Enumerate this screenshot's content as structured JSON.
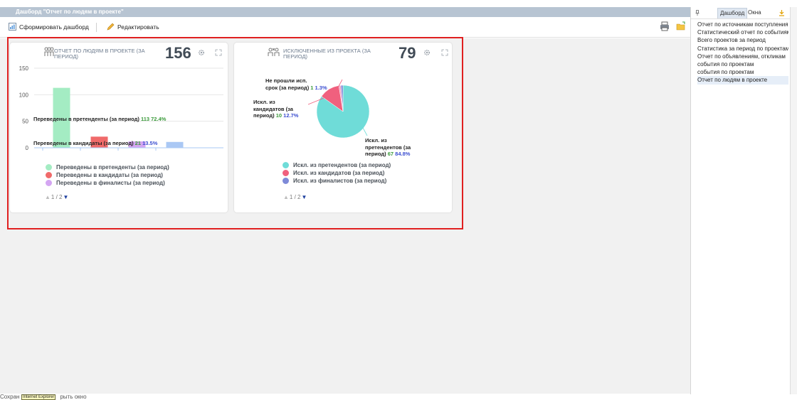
{
  "window": {
    "title": "Дашборд \"Отчет по людям в проекте\""
  },
  "toolbar": {
    "build_label": "Сформировать дашборд",
    "edit_label": "Редактировать"
  },
  "card1": {
    "title": "ОТЧЕТ ПО ЛЮДЯМ В ПРОЕКТЕ (ЗА ПЕРИОД)",
    "total": "156",
    "pager": "1 / 2",
    "label_a_text": "Переведены в претенденты (за период)",
    "label_a_count": "113",
    "label_a_pct": "72.4%",
    "label_b_text": "Переведены в кандидаты (за период)",
    "label_b_count": "21",
    "label_b_pct": "13.5%",
    "legend": [
      {
        "name": "Переведены в претенденты (за период)",
        "color": "#a4ecc3"
      },
      {
        "name": "Переведены в кандидаты (за период)",
        "color": "#f06a6a"
      },
      {
        "name": "Переведены в финалисты (за период)",
        "color": "#d4a6f2"
      }
    ]
  },
  "card2": {
    "title": "ИСКЛЮЧЕННЫЕ ИЗ ПРОЕКТА (ЗА ПЕРИОД)",
    "total": "79",
    "pager": "1 / 2",
    "label_1_line1": "Не прошли исп.",
    "label_1_line2": "срок (за период)",
    "label_1_count": "1",
    "label_1_pct": "1.3%",
    "label_2_line1": "Искл. из",
    "label_2_line2": "кандидатов (за",
    "label_2_line3": "период)",
    "label_2_count": "10",
    "label_2_pct": "12.7%",
    "label_3_line1": "Искл. из",
    "label_3_line2": "претендентов (за",
    "label_3_line3": "период)",
    "label_3_count": "67",
    "label_3_pct": "84.8%",
    "legend": [
      {
        "name": "Искл. из претендентов (за период)",
        "color": "#6fdcd8"
      },
      {
        "name": "Искл. из кандидатов (за период)",
        "color": "#f0607e"
      },
      {
        "name": "Искл. из финалистов (за период)",
        "color": "#7e8ad8"
      }
    ]
  },
  "chart_data": [
    {
      "type": "bar",
      "categories": [
        "Переведены в претенденты (за период)",
        "Переведены в кандидаты (за период)",
        "Переведены в финалисты (за период)",
        ""
      ],
      "values": [
        113,
        21,
        12,
        11
      ],
      "colors": [
        "#a4ecc3",
        "#f06a6a",
        "#d4a6f2",
        "#aac8f4"
      ],
      "yticks": [
        "0",
        "50",
        "100",
        "150"
      ],
      "ylim": [
        0,
        150
      ],
      "grid": true
    },
    {
      "type": "pie",
      "slices": [
        {
          "label": "Искл. из претендентов (за период)",
          "value": 67,
          "percent": 84.8,
          "color": "#6fdcd8"
        },
        {
          "label": "Искл. из кандидатов (за период)",
          "value": 10,
          "percent": 12.7,
          "color": "#f0607e"
        },
        {
          "label": "Не прошли исп. срок (за период)",
          "value": 1,
          "percent": 1.3,
          "color": "#f3a6c8"
        },
        {
          "label": "Искл. из финалистов (за период)",
          "value": 1,
          "percent": 1.2,
          "color": "#7e8ad8"
        }
      ]
    }
  ],
  "side_panel": {
    "tab_dashboard": "Дашборд",
    "tab_windows": "Окна",
    "items": [
      "Отчет по источникам поступления",
      "Статистический отчет по событиям",
      "Всего проектов за период",
      "Статистика за период по проектам",
      "Отчет по объявлениям, откликам",
      "события по проектам",
      "события по проектам",
      "Отчет по людям в проекте"
    ]
  },
  "status": {
    "text_before": "Сохран",
    "tooltip": "Internet Explorer",
    "text_after": "рыть окно"
  }
}
